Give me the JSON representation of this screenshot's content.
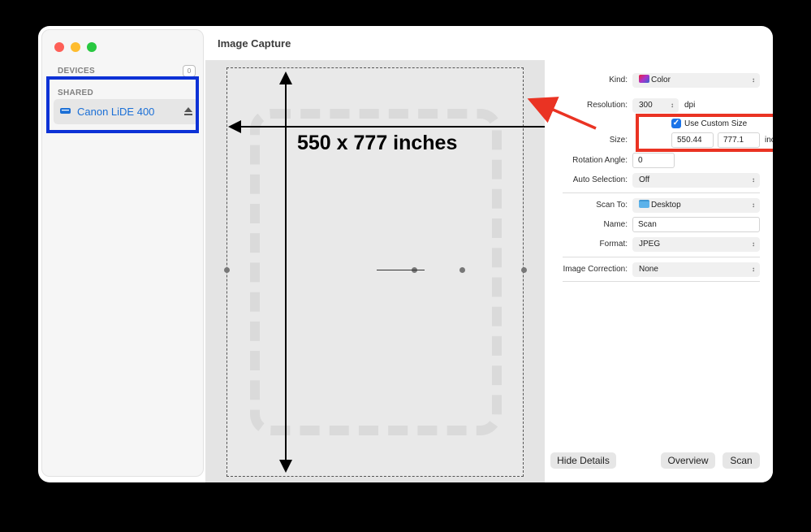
{
  "window": {
    "title": "Image Capture"
  },
  "sidebar": {
    "devices_label": "DEVICES",
    "devices_count": "0",
    "shared_label": "SHARED",
    "device_name": "Canon LiDE 400",
    "device_icon": "scanner-icon",
    "eject_icon": "eject-icon"
  },
  "preview": {
    "size_caption": "550 x 777 inches"
  },
  "details": {
    "kind": {
      "label": "Kind:",
      "value": "Color"
    },
    "resolution": {
      "label": "Resolution:",
      "value": "300",
      "unit": "dpi"
    },
    "custom_size": {
      "checkbox_label": "Use Custom Size",
      "checked": true
    },
    "size": {
      "label": "Size:",
      "width": "550.44",
      "height": "777.1",
      "unit": "inches"
    },
    "rotation": {
      "label": "Rotation Angle:",
      "value": "0"
    },
    "auto_selection": {
      "label": "Auto Selection:",
      "value": "Off"
    },
    "scan_to": {
      "label": "Scan To:",
      "value": "Desktop"
    },
    "name": {
      "label": "Name:",
      "value": "Scan"
    },
    "format": {
      "label": "Format:",
      "value": "JPEG"
    },
    "image_correction": {
      "label": "Image Correction:",
      "value": "None"
    }
  },
  "buttons": {
    "hide_details": "Hide Details",
    "overview": "Overview",
    "scan": "Scan"
  },
  "colors": {
    "highlight_blue": "#0d32d6",
    "highlight_red": "#ea3323",
    "link_blue": "#1b6fd6"
  }
}
